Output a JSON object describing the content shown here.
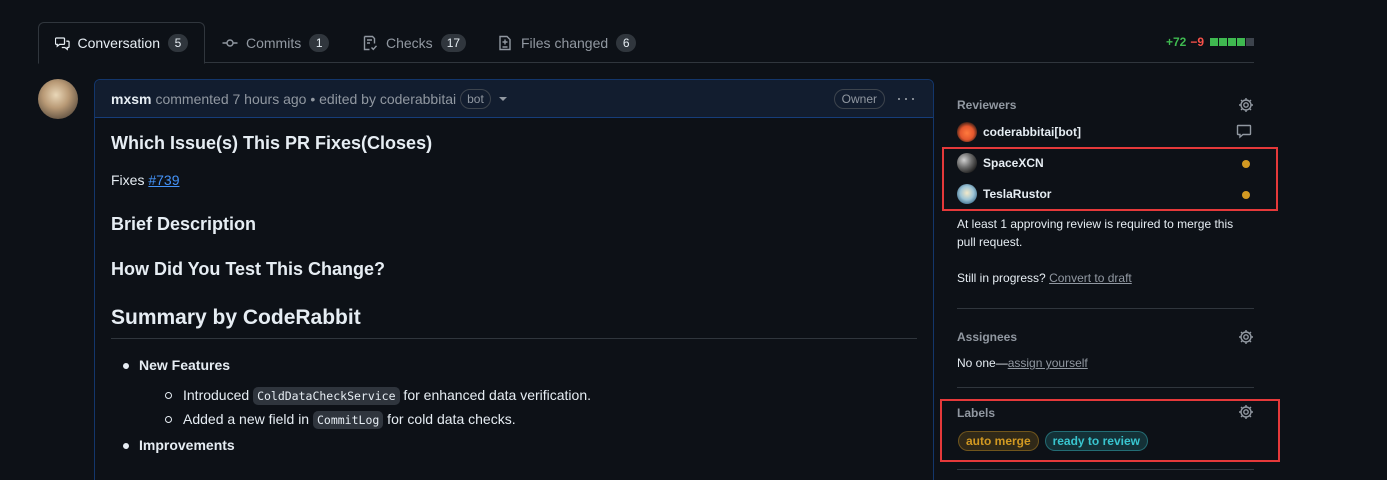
{
  "tabs": [
    {
      "label": "Conversation",
      "count": "5",
      "icon": "comment-discussion-icon"
    },
    {
      "label": "Commits",
      "count": "1",
      "icon": "git-commit-icon"
    },
    {
      "label": "Checks",
      "count": "17",
      "icon": "checklist-icon"
    },
    {
      "label": "Files changed",
      "count": "6",
      "icon": "file-diff-icon"
    }
  ],
  "diffstat": {
    "additions": "+72",
    "deletions": "−9",
    "bar_colors": [
      "#3fb950",
      "#3fb950",
      "#3fb950",
      "#3fb950",
      "#3d444d"
    ]
  },
  "comment": {
    "author": "mxsm",
    "meta": "commented 7 hours ago • edited by coderabbitai",
    "bot_badge": "bot",
    "owner_badge": "Owner",
    "more": "···",
    "body": {
      "h_issue": "Which Issue(s) This PR Fixes(Closes)",
      "fixes_prefix": "Fixes ",
      "fixes_link": "#739",
      "h_brief": "Brief Description",
      "h_test": "How Did You Test This Change?",
      "h_summary": "Summary by CodeRabbit",
      "new_features": "New Features",
      "nf_item1_pre": "Introduced ",
      "nf_item1_code": "ColdDataCheckService",
      "nf_item1_post": " for enhanced data verification.",
      "nf_item2_pre": "Added a new field in ",
      "nf_item2_code": "CommitLog",
      "nf_item2_post": " for cold data checks.",
      "improvements": "Improvements"
    }
  },
  "sidebar": {
    "reviewers": {
      "title": "Reviewers",
      "items": [
        {
          "name": "coderabbitai[bot]",
          "status": "commented"
        },
        {
          "name": "SpaceXCN",
          "status": "pending"
        },
        {
          "name": "TeslaRustor",
          "status": "pending"
        }
      ],
      "requirement": "At least 1 approving review is required to merge this pull request.",
      "progress_text": "Still in progress?",
      "convert_link": "Convert to draft"
    },
    "assignees": {
      "title": "Assignees",
      "none_text": "No one—",
      "assign_link": "assign yourself"
    },
    "labels": {
      "title": "Labels",
      "items": [
        {
          "name": "auto merge",
          "color": "#d29922"
        },
        {
          "name": "ready to review",
          "color": "#39c5cf"
        }
      ]
    }
  }
}
